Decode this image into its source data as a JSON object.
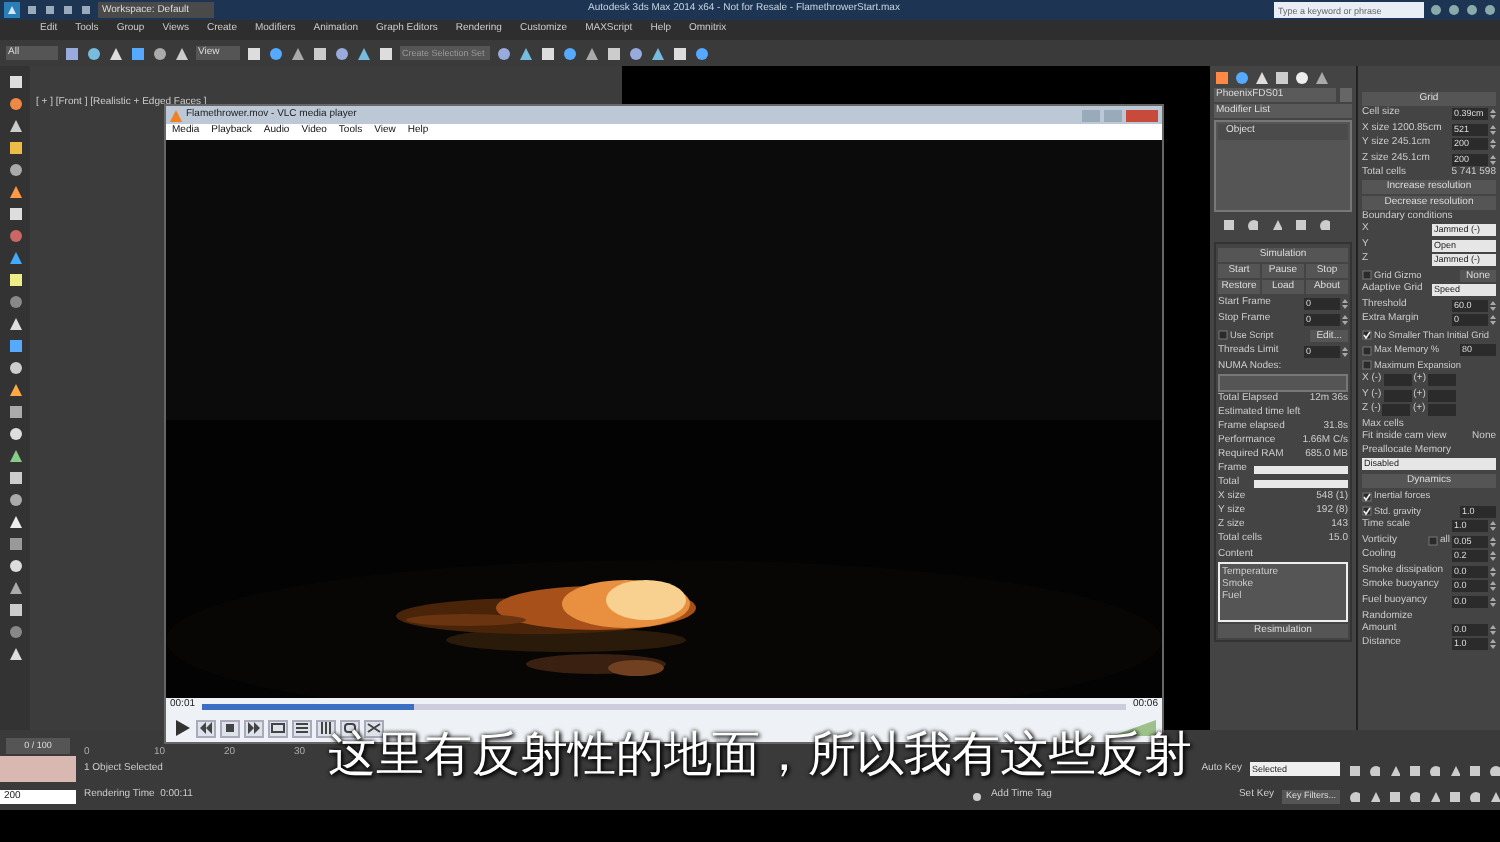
{
  "title_bar": {
    "workspace": "Workspace: Default",
    "title": "Autodesk 3ds Max 2014 x64 - Not for Resale - FlamethrowerStart.max",
    "search_placeholder": "Type a keyword or phrase"
  },
  "menu": [
    "Edit",
    "Tools",
    "Group",
    "Views",
    "Create",
    "Modifiers",
    "Animation",
    "Graph Editors",
    "Rendering",
    "Customize",
    "MAXScript",
    "Help",
    "Omnitrix"
  ],
  "toolbar": {
    "filter": "All",
    "reference": "View",
    "selection_set": "Create Selection Set"
  },
  "viewport": {
    "label": "[ + ] [Front ] [Realistic + Edged Faces ]"
  },
  "player": {
    "title": "Flamethrower.mov - VLC media player",
    "menu": [
      "Media",
      "Playback",
      "Audio",
      "Video",
      "Tools",
      "View",
      "Help"
    ],
    "elapsed": "00:01",
    "total": "00:06",
    "level": 0.23,
    "subtitle": "这里有反射性的地面，所以我有这些反射"
  },
  "command_panel": {
    "object_name": "PhoenixFDS01",
    "modifier_list": "Modifier List",
    "stack": [
      "Object"
    ],
    "rollout": [
      {
        "kind": "header",
        "label": "Simulation"
      },
      {
        "kind": "buttons",
        "labels": [
          "Start",
          "Pause",
          "Stop"
        ]
      },
      {
        "kind": "buttons",
        "labels": [
          "Restore",
          "Load",
          "About"
        ]
      },
      {
        "kind": "field",
        "label": "Start Frame",
        "value": "0"
      },
      {
        "kind": "field",
        "label": "Stop Frame",
        "value": "0"
      },
      {
        "kind": "check",
        "label": "Use Script",
        "checked": false,
        "button": "Edit..."
      },
      {
        "kind": "field",
        "label": "Threads Limit",
        "value": "0"
      },
      {
        "kind": "label",
        "label": "NUMA Nodes:"
      },
      {
        "kind": "box"
      },
      {
        "kind": "info",
        "label": "Total Elapsed",
        "value": "12m 36s"
      },
      {
        "kind": "info",
        "label": "Estimated time left"
      },
      {
        "kind": "info",
        "label": "Frame elapsed",
        "value": "31.8s"
      },
      {
        "kind": "info",
        "label": "Performance",
        "value": "1.66M C/s"
      },
      {
        "kind": "info",
        "label": "Required RAM",
        "value": "685.0 MB"
      },
      {
        "kind": "bar",
        "label": "Frame"
      },
      {
        "kind": "bar",
        "label": "Total"
      },
      {
        "kind": "info",
        "label": "X size",
        "value": "548 (1)"
      },
      {
        "kind": "info",
        "label": "Y size",
        "value": "192 (8)"
      },
      {
        "kind": "info",
        "label": "Z size",
        "value": "143"
      },
      {
        "kind": "info",
        "label": "Total cells",
        "value": "15.0"
      },
      {
        "kind": "label",
        "label": "Content"
      },
      {
        "kind": "list",
        "items": [
          "Temperature",
          "Smoke",
          "Fuel"
        ]
      },
      {
        "kind": "button",
        "label": "Resimulation"
      }
    ]
  },
  "grid_panel": [
    {
      "kind": "header",
      "label": "Grid"
    },
    {
      "kind": "field",
      "label": "Cell size",
      "value": "0.39cm"
    },
    {
      "kind": "field",
      "label": "X size  1200.85cm",
      "value": "521"
    },
    {
      "kind": "field",
      "label": "Y size  245.1cm",
      "value": "200"
    },
    {
      "kind": "field",
      "label": "Z size  245.1cm",
      "value": "200"
    },
    {
      "kind": "info",
      "label": "Total cells",
      "value": "5 741 598"
    },
    {
      "kind": "button",
      "label": "Increase resolution"
    },
    {
      "kind": "button",
      "label": "Decrease resolution"
    },
    {
      "kind": "label",
      "label": "Boundary conditions"
    },
    {
      "kind": "dropdown",
      "label": "X",
      "value": "Jammed (-)"
    },
    {
      "kind": "dropdown",
      "label": "Y",
      "value": "Open"
    },
    {
      "kind": "dropdown",
      "label": "Z",
      "value": "Jammed (-)"
    },
    {
      "kind": "check",
      "label": "Grid Gizmo",
      "checked": false,
      "button": "None"
    },
    {
      "kind": "dropdown",
      "label": "Adaptive Grid",
      "value": "Speed"
    },
    {
      "kind": "field",
      "label": "Threshold",
      "value": "60.0"
    },
    {
      "kind": "field",
      "label": "Extra Margin",
      "value": "0"
    },
    {
      "kind": "check",
      "label": "No Smaller Than Initial Grid",
      "checked": true
    },
    {
      "kind": "check",
      "label": "Max Memory %",
      "checked": false,
      "value": "80"
    },
    {
      "kind": "check",
      "label": "Maximum Expansion",
      "checked": false
    },
    {
      "kind": "pair",
      "labels": [
        "X (-)",
        "(+)"
      ]
    },
    {
      "kind": "pair",
      "labels": [
        "Y (-)",
        "(+)"
      ]
    },
    {
      "kind": "pair",
      "labels": [
        "Z (-)",
        "(+)"
      ]
    },
    {
      "kind": "label",
      "label": "Max cells"
    },
    {
      "kind": "info",
      "label": "Fit inside cam view",
      "value": "None"
    },
    {
      "kind": "label",
      "label": "Preallocate Memory"
    },
    {
      "kind": "dropdown",
      "value": "Disabled"
    },
    {
      "kind": "header",
      "label": "Dynamics"
    },
    {
      "kind": "check",
      "label": "Inertial forces",
      "checked": true
    },
    {
      "kind": "check",
      "label": "Std. gravity",
      "checked": true,
      "value": "1.0"
    },
    {
      "kind": "field",
      "label": "Time scale",
      "value": "1.0"
    },
    {
      "kind": "field",
      "label": "Vorticity",
      "value": "0.05",
      "check": {
        "label": "all",
        "checked": false
      }
    },
    {
      "kind": "field",
      "label": "Cooling",
      "value": "0.2"
    },
    {
      "kind": "field",
      "label": "Smoke dissipation",
      "value": "0.0"
    },
    {
      "kind": "field",
      "label": "Smoke buoyancy",
      "value": "0.0"
    },
    {
      "kind": "field",
      "label": "Fuel buoyancy",
      "value": "0.0"
    },
    {
      "kind": "label",
      "label": "Randomize"
    },
    {
      "kind": "field",
      "label": "Amount",
      "value": "0.0"
    },
    {
      "kind": "field",
      "label": "Distance",
      "value": "1.0"
    }
  ],
  "status": {
    "frame": "0 / 100",
    "ticks": [
      "0",
      "10",
      "20",
      "30"
    ],
    "selection": "1 Object Selected",
    "render_time": "Rendering Time  0:00:11",
    "frame_field": "200",
    "time_tag": "Add Time Tag",
    "auto_key": "Auto Key",
    "key_mode": "Selected",
    "set_key": "Set Key",
    "key_filters": "Key Filters..."
  }
}
